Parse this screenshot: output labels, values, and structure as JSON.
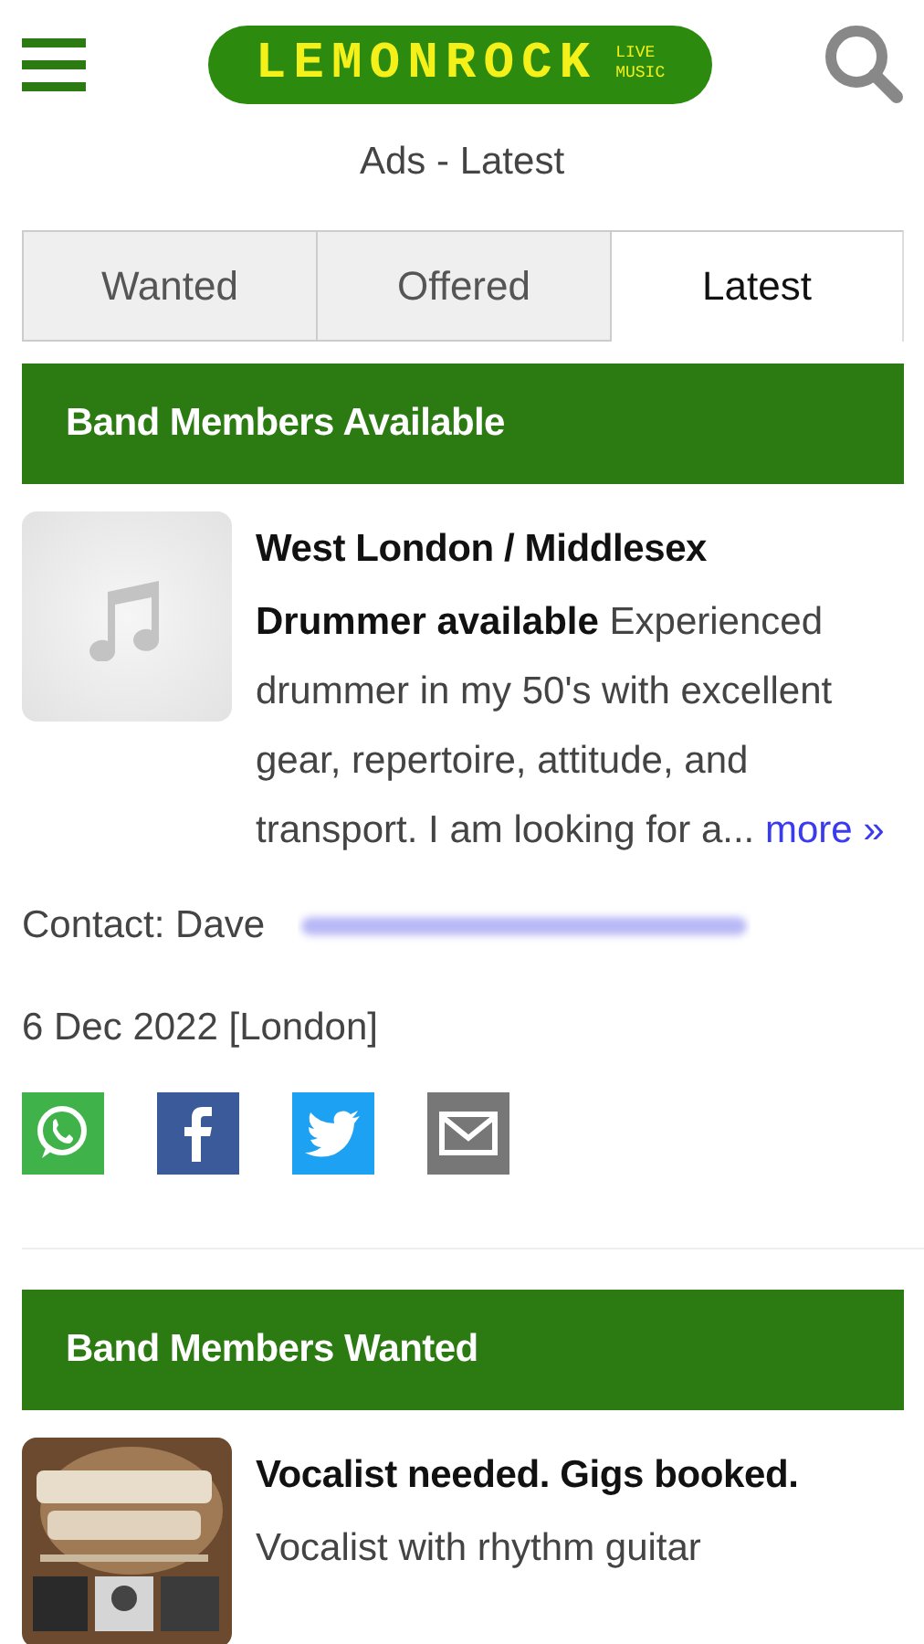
{
  "header": {
    "logo": {
      "wordmark": "LEMONROCK",
      "tagline": [
        "LIVE",
        "MUSIC"
      ]
    }
  },
  "page_title": "Ads - Latest",
  "tabs": [
    {
      "label": "Wanted",
      "selected": false
    },
    {
      "label": "Offered",
      "selected": false
    },
    {
      "label": "Latest",
      "selected": true
    }
  ],
  "sections": [
    {
      "heading": "Band Members Available",
      "ads": [
        {
          "thumbnail": {
            "kind": "placeholder"
          },
          "location": "West London / Middlesex",
          "text": "**Drummer available** Experienced drummer in my 50's with excellent gear, repertoire, attitude, and transport. I am looking for a...",
          "more": "more »",
          "contact": "Contact: Dave",
          "contact_email_blurred": true,
          "date": "6 Dec 2022 [London]",
          "share": [
            {
              "kind": "whatsapp"
            },
            {
              "kind": "facebook"
            },
            {
              "kind": "twitter"
            },
            {
              "kind": "email"
            }
          ]
        }
      ]
    },
    {
      "heading": "Band Members Wanted",
      "ads": [
        {
          "location": "Vocalist needed. Gigs booked.",
          "text": "Vocalist with rhythm guitar"
        }
      ]
    }
  ]
}
